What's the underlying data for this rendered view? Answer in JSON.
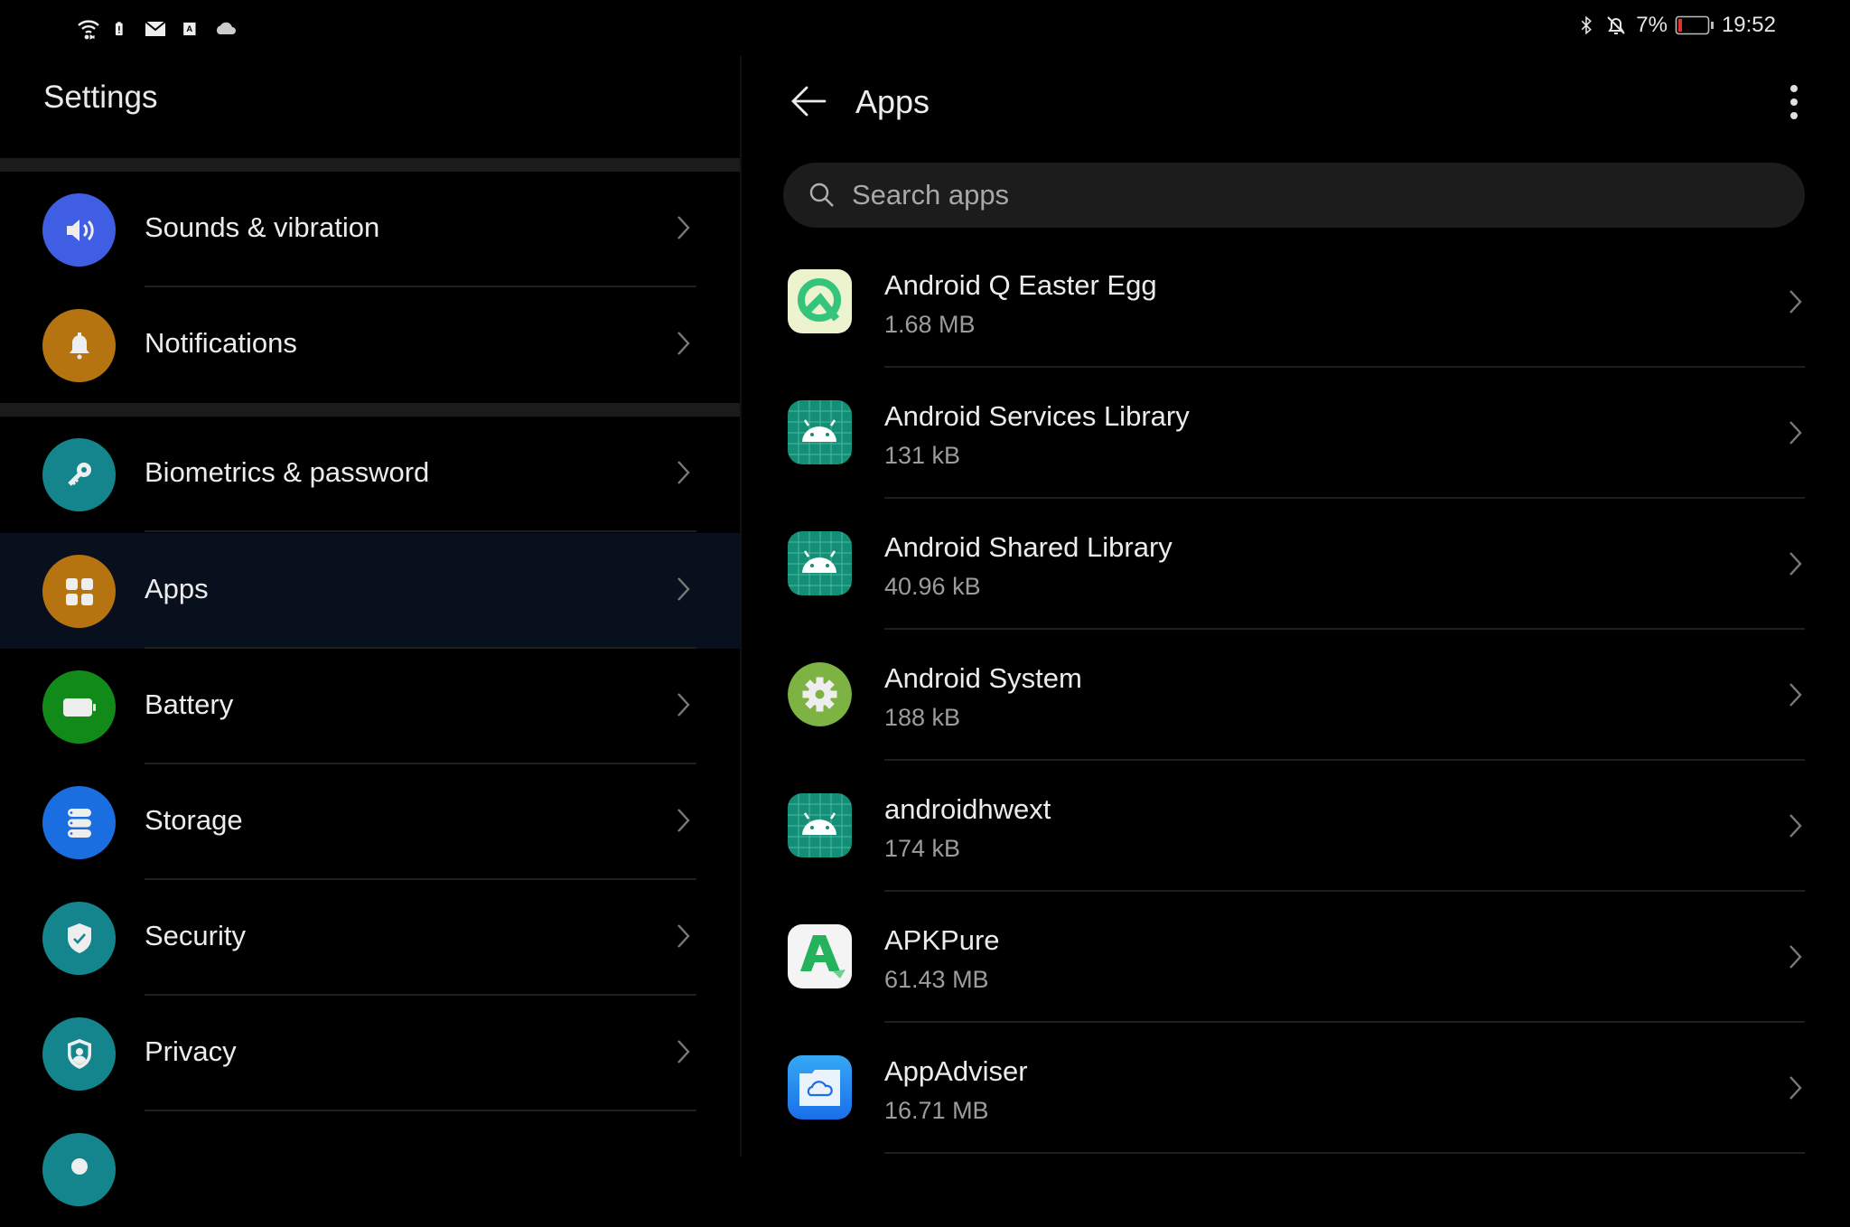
{
  "status_bar": {
    "left_icons": [
      "wifi-icon",
      "battery-alert-icon",
      "mail-icon",
      "a-badge-icon",
      "cloud-icon"
    ],
    "right_icons": [
      "bluetooth-icon",
      "bell-off-icon"
    ],
    "battery_percent": "7%",
    "battery_level": 0.07,
    "time": "19:52"
  },
  "sidebar": {
    "title": "Settings",
    "items": [
      {
        "label": "Sounds & vibration",
        "icon": "speaker-icon",
        "color": "#3f5ee3"
      },
      {
        "label": "Notifications",
        "icon": "bell-icon",
        "color": "#b5740f"
      },
      {
        "label": "Biometrics & password",
        "icon": "key-icon",
        "color": "#15858d"
      },
      {
        "label": "Apps",
        "icon": "apps-grid-icon",
        "color": "#b5740f",
        "selected": true
      },
      {
        "label": "Battery",
        "icon": "battery-icon",
        "color": "#128a1a"
      },
      {
        "label": "Storage",
        "icon": "storage-icon",
        "color": "#1b6ee0"
      },
      {
        "label": "Security",
        "icon": "shield-check-icon",
        "color": "#15858d"
      },
      {
        "label": "Privacy",
        "icon": "privacy-shield-icon",
        "color": "#15858d"
      },
      {
        "label": "",
        "icon": "partial-icon",
        "color": "#15858d"
      }
    ]
  },
  "main": {
    "title": "Apps",
    "back_icon": "back-arrow-icon",
    "more_icon": "more-vert-icon",
    "search": {
      "placeholder": "Search apps",
      "value": ""
    },
    "apps": [
      {
        "name": "Android Q Easter Egg",
        "size": "1.68 MB",
        "icon": "android-q-icon"
      },
      {
        "name": "Android Services Library",
        "size": "131 kB",
        "icon": "android-default-icon"
      },
      {
        "name": "Android Shared Library",
        "size": "40.96 kB",
        "icon": "android-default-icon"
      },
      {
        "name": "Android System",
        "size": "188 kB",
        "icon": "android-system-gear-icon"
      },
      {
        "name": "androidhwext",
        "size": "174 kB",
        "icon": "android-default-icon"
      },
      {
        "name": "APKPure",
        "size": "61.43 MB",
        "icon": "apkpure-icon"
      },
      {
        "name": "AppAdviser",
        "size": "16.71 MB",
        "icon": "appadviser-icon"
      }
    ]
  },
  "colors": {
    "background": "#000000",
    "selected_row": "#07101c",
    "search_bg": "#1c1c1c",
    "battery_low": "#e0342a"
  }
}
